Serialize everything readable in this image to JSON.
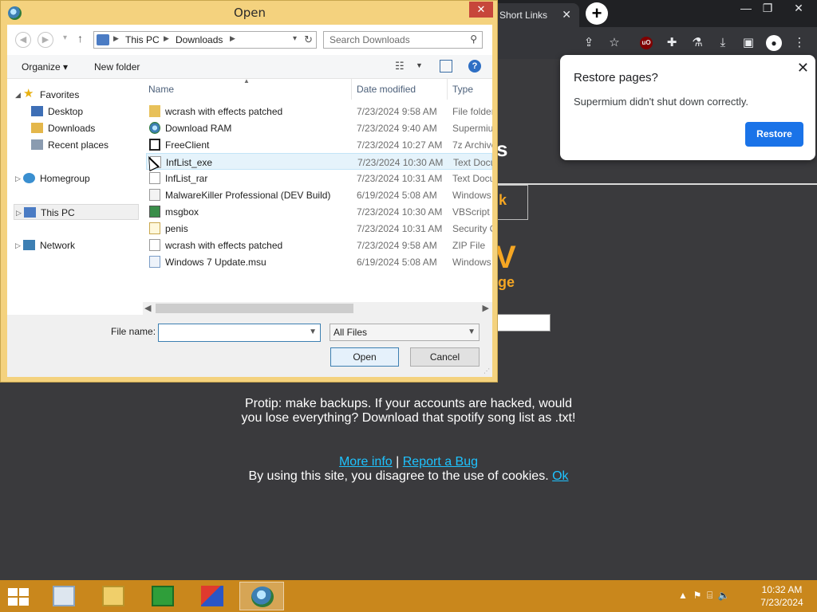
{
  "browser": {
    "tab_label": "Short Links",
    "tab_close": "✕",
    "new_tab": "+",
    "window_controls": [
      "—",
      "❐",
      "✕"
    ]
  },
  "page": {
    "big_letter": "s",
    "orange_box_text": "k",
    "orange_big": "V",
    "orange_small": "ge",
    "protip": "Protip: make backups. If your accounts are hacked, would you lose everything? Download that spotify song list as .txt!",
    "more_info": "More info",
    "separator": "|",
    "report_bug": "Report a Bug",
    "cookies_text": "By using this site, you disagree to the use of cookies.",
    "ok": "Ok"
  },
  "restore_popup": {
    "title": "Restore pages?",
    "message": "Supermium didn't shut down correctly.",
    "button": "Restore",
    "close": "✕"
  },
  "dialog": {
    "title": "Open",
    "close": "✕",
    "address": [
      "This PC",
      "Downloads"
    ],
    "search_placeholder": "Search Downloads",
    "organize": "Organize ▾",
    "new_folder": "New folder",
    "tree": [
      {
        "label": "Favorites",
        "icon": "star-icon"
      },
      {
        "label": "Desktop",
        "icon": "desktop-icon"
      },
      {
        "label": "Downloads",
        "icon": "downloads-folder-icon"
      },
      {
        "label": "Recent places",
        "icon": "recent-places-icon"
      },
      {
        "label": "Homegroup",
        "icon": "homegroup-icon"
      },
      {
        "label": "This PC",
        "icon": "computer-icon"
      },
      {
        "label": "Network",
        "icon": "network-icon"
      }
    ],
    "columns": [
      "Name",
      "Date modified",
      "Type"
    ],
    "files": [
      {
        "name": "wcrash with effects patched",
        "date": "7/23/2024 9:58 AM",
        "type": "File folder",
        "icon": "folder-icon"
      },
      {
        "name": "Download RAM",
        "date": "7/23/2024 9:40 AM",
        "type": "Supermiu",
        "icon": "browser-app-icon"
      },
      {
        "name": "FreeClient",
        "date": "7/23/2024 10:27 AM",
        "type": "7z Archive",
        "icon": "archive-icon"
      },
      {
        "name": "InfList_exe",
        "date": "7/23/2024 10:30 AM",
        "type": "Text Docu",
        "icon": "text-doc-icon"
      },
      {
        "name": "InfList_rar",
        "date": "7/23/2024 10:31 AM",
        "type": "Text Docu",
        "icon": "text-doc-icon"
      },
      {
        "name": "MalwareKiller Professional (DEV Build)",
        "date": "6/19/2024 5:08 AM",
        "type": "Windows",
        "icon": "doc-icon"
      },
      {
        "name": "msgbox",
        "date": "7/23/2024 10:30 AM",
        "type": "VBScript S",
        "icon": "script-icon"
      },
      {
        "name": "penis",
        "date": "7/23/2024 10:31 AM",
        "type": "Security C",
        "icon": "certificate-icon"
      },
      {
        "name": "wcrash with effects patched",
        "date": "7/23/2024 9:58 AM",
        "type": "ZIP File",
        "icon": "zip-icon"
      },
      {
        "name": "Windows 7 Update.msu",
        "date": "6/19/2024 5:08 AM",
        "type": "Windows",
        "icon": "msu-icon"
      }
    ],
    "file_name_label": "File name:",
    "file_name_value": "",
    "file_type": "All Files",
    "open_button": "Open",
    "cancel_button": "Cancel"
  },
  "taskbar": {
    "apps": [
      "control-panel-icon",
      "file-explorer-icon",
      "store-icon",
      "paint-icon",
      "supermium-icon"
    ],
    "time": "10:32 AM",
    "date": "7/23/2024"
  }
}
